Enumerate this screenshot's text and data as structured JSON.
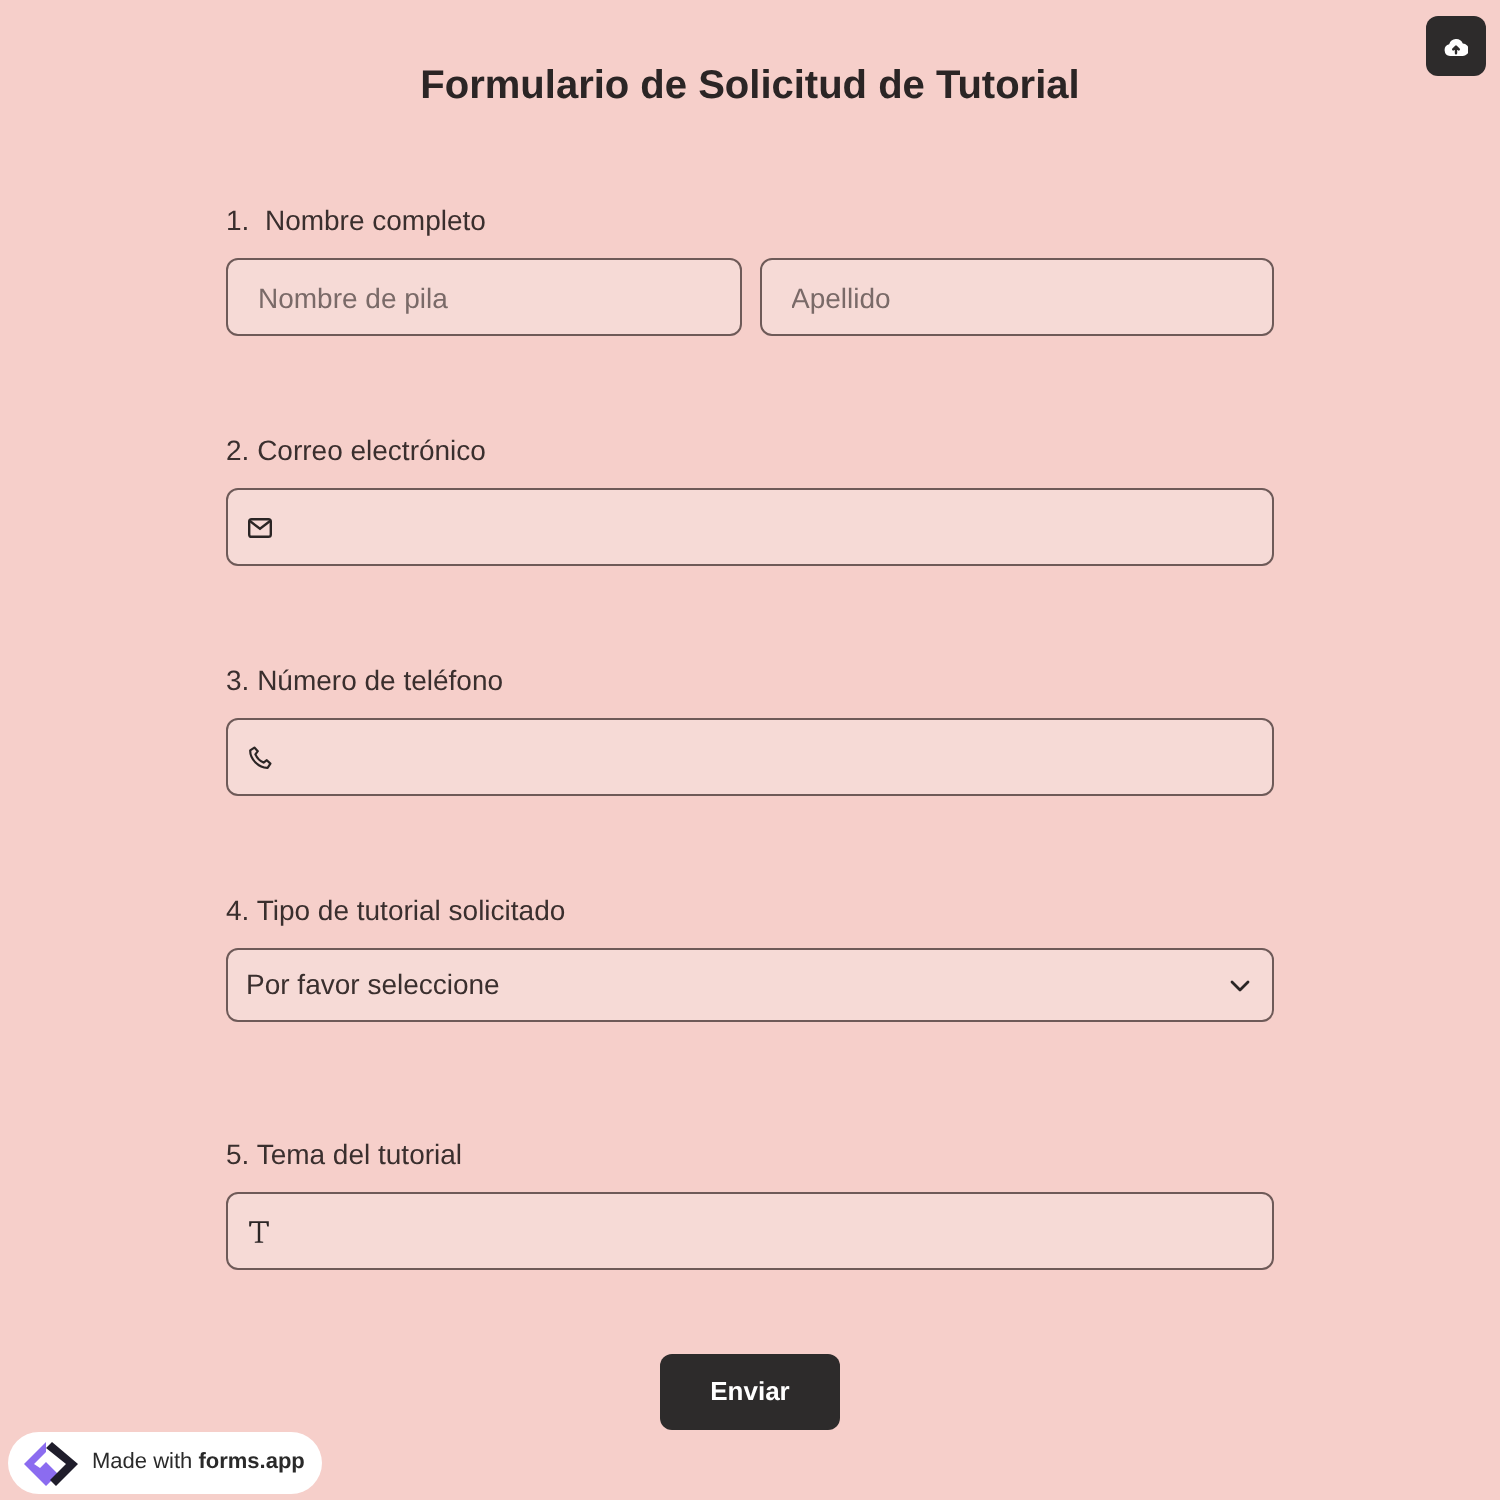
{
  "title": "Formulario de Solicitud de Tutorial",
  "questions": [
    {
      "kind": "name",
      "label": "1.  Nombre completo",
      "fields": [
        {
          "placeholder": "Nombre de pila"
        },
        {
          "placeholder": "Apellido"
        }
      ]
    },
    {
      "kind": "email",
      "label": "2. Correo electrónico"
    },
    {
      "kind": "phone",
      "label": "3. Número de teléfono"
    },
    {
      "kind": "select",
      "label": "4. Tipo de tutorial solicitado",
      "placeholder": "Por favor seleccione"
    },
    {
      "kind": "text",
      "label": "5. Tema del tutorial"
    }
  ],
  "submit_button": {
    "label": "Enviar"
  },
  "badge": {
    "text": "Made with **forms.app**"
  }
}
